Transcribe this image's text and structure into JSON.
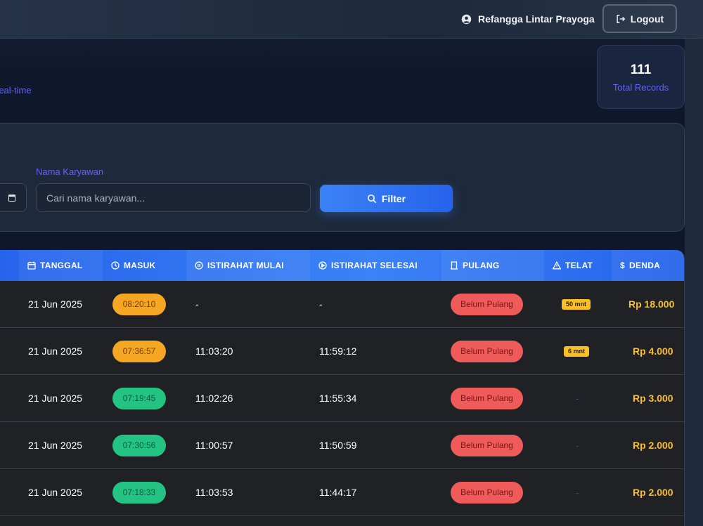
{
  "topbar": {
    "user_name": "Refangga Lintar Prayoga",
    "logout_label": "Logout"
  },
  "header": {
    "subtitle": "real-time"
  },
  "stats": {
    "total_value": "111",
    "total_label": "Total Records"
  },
  "filter": {
    "name_label": "Nama Karyawan",
    "name_placeholder": "Cari nama karyawan...",
    "button_label": "Filter"
  },
  "table": {
    "headers": {
      "tanggal": "TANGGAL",
      "masuk": "MASUK",
      "istirahat_mulai": "ISTIRAHAT MULAI",
      "istirahat_selesai": "ISTIRAHAT SELESAI",
      "pulang": "PULANG",
      "telat": "TELAT",
      "denda": "DENDA"
    },
    "rows": [
      {
        "tanggal": "21 Jun 2025",
        "masuk": "08:20:10",
        "ist_mulai": "-",
        "ist_selesai": "-",
        "pulang": "Belum Pulang",
        "telat": "50 mnt",
        "denda": "Rp 18.000"
      },
      {
        "tanggal": "21 Jun 2025",
        "masuk": "07:36:57",
        "ist_mulai": "11:03:20",
        "ist_selesai": "11:59:12",
        "pulang": "Belum Pulang",
        "telat": "6 mnt",
        "denda": "Rp 4.000"
      },
      {
        "tanggal": "21 Jun 2025",
        "masuk": "07:19:45",
        "ist_mulai": "11:02:26",
        "ist_selesai": "11:55:34",
        "pulang": "Belum Pulang",
        "telat": "-",
        "denda": "Rp 3.000"
      },
      {
        "tanggal": "21 Jun 2025",
        "masuk": "07:30:56",
        "ist_mulai": "11:00:57",
        "ist_selesai": "11:50:59",
        "pulang": "Belum Pulang",
        "telat": "-",
        "denda": "Rp 2.000"
      },
      {
        "tanggal": "21 Jun 2025",
        "masuk": "07:18:33",
        "ist_mulai": "11:03:53",
        "ist_selesai": "11:44:17",
        "pulang": "Belum Pulang",
        "telat": "-",
        "denda": "Rp 2.000"
      }
    ]
  },
  "colors": {
    "late_pill": "#f5a623",
    "ontime_pill": "#22c383",
    "pulang_pill": "#ef5b5b",
    "fine_text": "#fbbf24",
    "accent": "#3b82f6"
  },
  "icons": [
    "user-circle-icon",
    "logout-icon",
    "calendar-icon",
    "search-icon",
    "clock-icon",
    "pause-icon",
    "play-icon",
    "door-icon",
    "warning-icon",
    "dollar-icon"
  ]
}
